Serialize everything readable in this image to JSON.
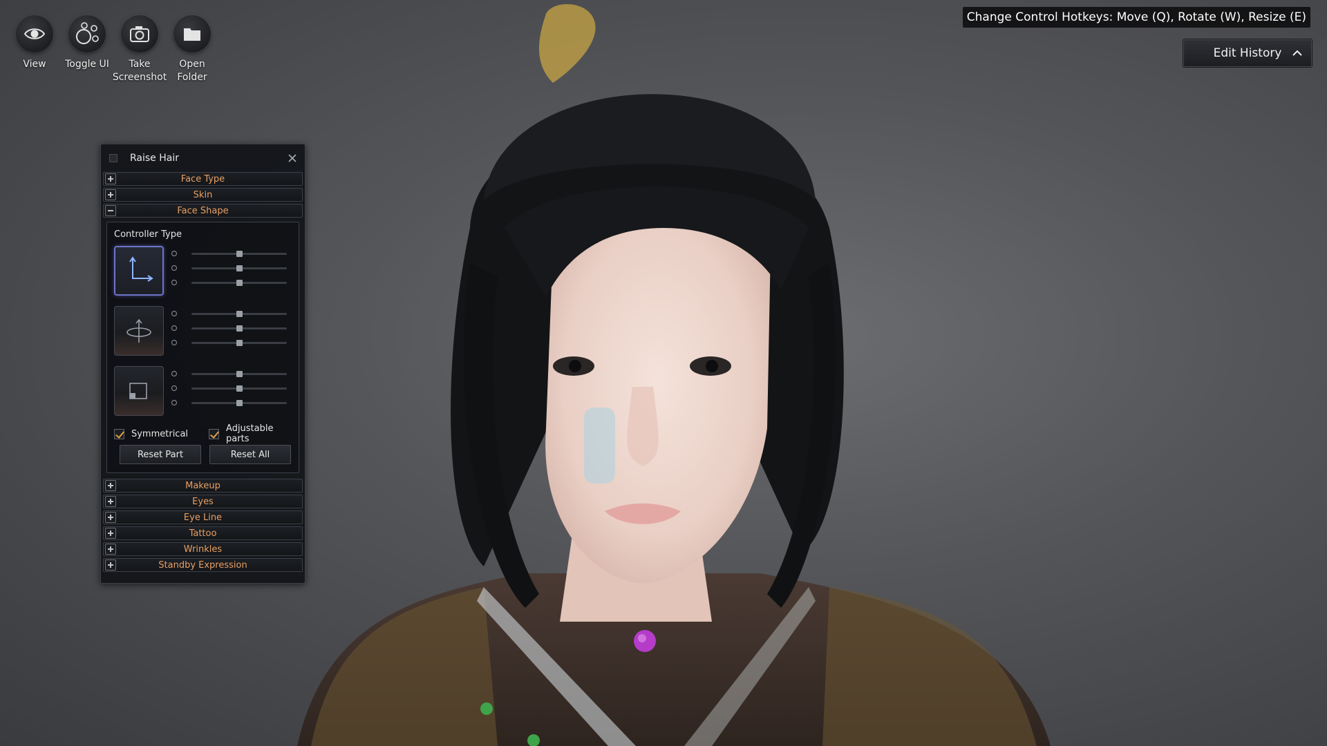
{
  "toolbar": {
    "view": {
      "label": "View",
      "icon": "eye-icon"
    },
    "toggle_ui": {
      "label": "Toggle UI",
      "icon": "circles-icon"
    },
    "screenshot": {
      "label": "Take Screenshot",
      "icon": "camera-icon"
    },
    "open_folder": {
      "label": "Open Folder",
      "icon": "folder-icon"
    }
  },
  "hotkey_tip": "Change Control Hotkeys: Move (Q), Rotate (W), Resize (E)",
  "edit_history": {
    "label": "Edit History",
    "icon": "chevron-up-icon"
  },
  "panel": {
    "title": "Raise Hair",
    "raise_hair_checked": false,
    "sections_top": [
      {
        "label": "Face Type",
        "expanded": false
      },
      {
        "label": "Skin",
        "expanded": false
      },
      {
        "label": "Face Shape",
        "expanded": true
      }
    ],
    "face_shape": {
      "controller_type_label": "Controller Type",
      "controllers": [
        {
          "name": "move",
          "icon": "move-axes-icon",
          "active": true,
          "slider_values": [
            0.5,
            0.5,
            0.5
          ]
        },
        {
          "name": "rotate",
          "icon": "rotate-icon",
          "active": false,
          "slider_values": [
            0.5,
            0.5,
            0.5
          ]
        },
        {
          "name": "resize",
          "icon": "resize-icon",
          "active": false,
          "slider_values": [
            0.5,
            0.5,
            0.5
          ]
        }
      ],
      "symmetrical": {
        "label": "Symmetrical",
        "checked": true
      },
      "adjustable_parts": {
        "label": "Adjustable parts",
        "checked": true
      },
      "reset_part": "Reset Part",
      "reset_all": "Reset All"
    },
    "sections_bottom": [
      {
        "label": "Makeup",
        "expanded": false
      },
      {
        "label": "Eyes",
        "expanded": false
      },
      {
        "label": "Eye Line",
        "expanded": false
      },
      {
        "label": "Tattoo",
        "expanded": false
      },
      {
        "label": "Wrinkles",
        "expanded": false
      },
      {
        "label": "Standby Expression",
        "expanded": false
      }
    ]
  },
  "colors": {
    "section_label": "#e8a064",
    "accent_active": "#6d74c9",
    "checkmark": "#e0a045",
    "handle": "#b43cc8"
  }
}
